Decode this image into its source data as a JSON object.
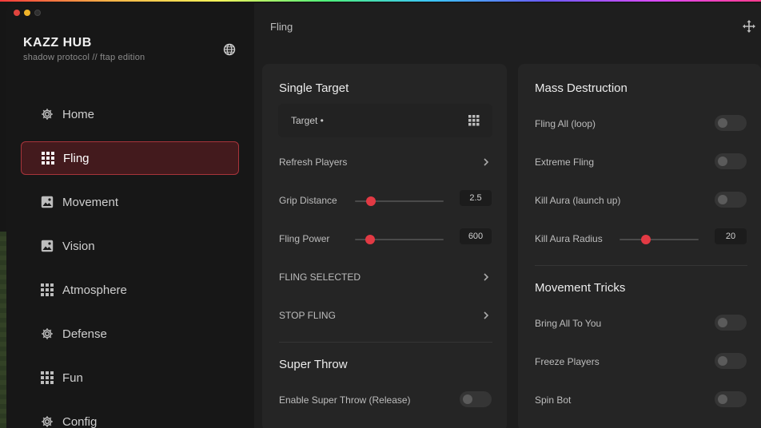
{
  "app": {
    "title": "KAZZ HUB",
    "subtitle": "shadow protocol // ftap edition"
  },
  "colors": {
    "accent": "#e23a44",
    "active_bg": "#431a1d",
    "active_border": "#a8343b"
  },
  "sidebar": {
    "items": [
      {
        "label": "Home",
        "icon": "gear-icon",
        "active": false
      },
      {
        "label": "Fling",
        "icon": "grid-icon",
        "active": true
      },
      {
        "label": "Movement",
        "icon": "image-icon",
        "active": false
      },
      {
        "label": "Vision",
        "icon": "image-icon",
        "active": false
      },
      {
        "label": "Atmosphere",
        "icon": "grid-icon",
        "active": false
      },
      {
        "label": "Defense",
        "icon": "gear-icon",
        "active": false
      },
      {
        "label": "Fun",
        "icon": "grid-icon",
        "active": false
      },
      {
        "label": "Config",
        "icon": "gear-icon",
        "active": false
      }
    ]
  },
  "main": {
    "title": "Fling",
    "single_target": {
      "title": "Single Target",
      "target_dropdown": "Target •",
      "refresh_players": "Refresh Players",
      "grip_distance": {
        "label": "Grip Distance",
        "value": "2.5",
        "fraction": 0.18
      },
      "fling_power": {
        "label": "Fling Power",
        "value": "600",
        "fraction": 0.17
      },
      "fling_selected": "FLING SELECTED",
      "stop_fling": "STOP FLING"
    },
    "super_throw": {
      "title": "Super Throw",
      "enable": {
        "label": "Enable Super Throw (Release)",
        "on": false
      }
    },
    "mass_destruction": {
      "title": "Mass Destruction",
      "fling_all": {
        "label": "Fling All (loop)",
        "on": false
      },
      "extreme_fling": {
        "label": "Extreme Fling",
        "on": false
      },
      "kill_aura": {
        "label": "Kill Aura (launch up)",
        "on": false
      },
      "kill_aura_radius": {
        "label": "Kill Aura Radius",
        "value": "20",
        "fraction": 0.33
      }
    },
    "movement_tricks": {
      "title": "Movement Tricks",
      "bring_all": {
        "label": "Bring All To You",
        "on": false
      },
      "freeze_players": {
        "label": "Freeze Players",
        "on": false
      },
      "spin_bot": {
        "label": "Spin Bot",
        "on": false
      }
    }
  }
}
